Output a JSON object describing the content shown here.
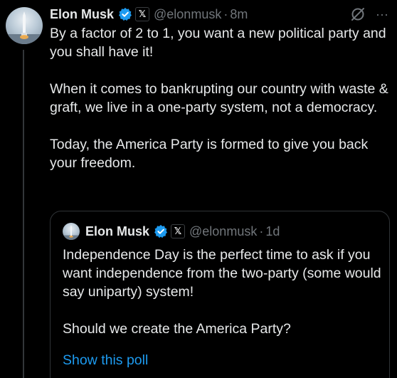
{
  "tweet": {
    "author": {
      "name": "Elon Musk",
      "handle": "@elonmusk",
      "time": "8m",
      "verified_color": "#1d9bf0",
      "affiliate_badge": "𝕏"
    },
    "paragraphs": [
      "By a factor of 2 to 1, you want a new political party and you shall have it!",
      "When it comes to bankrupting our country with waste & graft, we live in a one-party system, not a democracy.",
      "Today, the America Party is formed to give you back your freedom."
    ],
    "icons": {
      "grok": "grok-icon",
      "more": "more-icon"
    },
    "more_glyph": "···",
    "separator": "·"
  },
  "quote": {
    "author": {
      "name": "Elon Musk",
      "handle": "@elonmusk",
      "time": "1d",
      "affiliate_badge": "𝕏"
    },
    "paragraphs": [
      "Independence Day is the perfect time to ask if you want independence from the two-party (some would say uniparty) system!",
      "Should we create the America Party?"
    ],
    "poll_link": "Show this poll",
    "link_color": "#1d9bf0"
  }
}
